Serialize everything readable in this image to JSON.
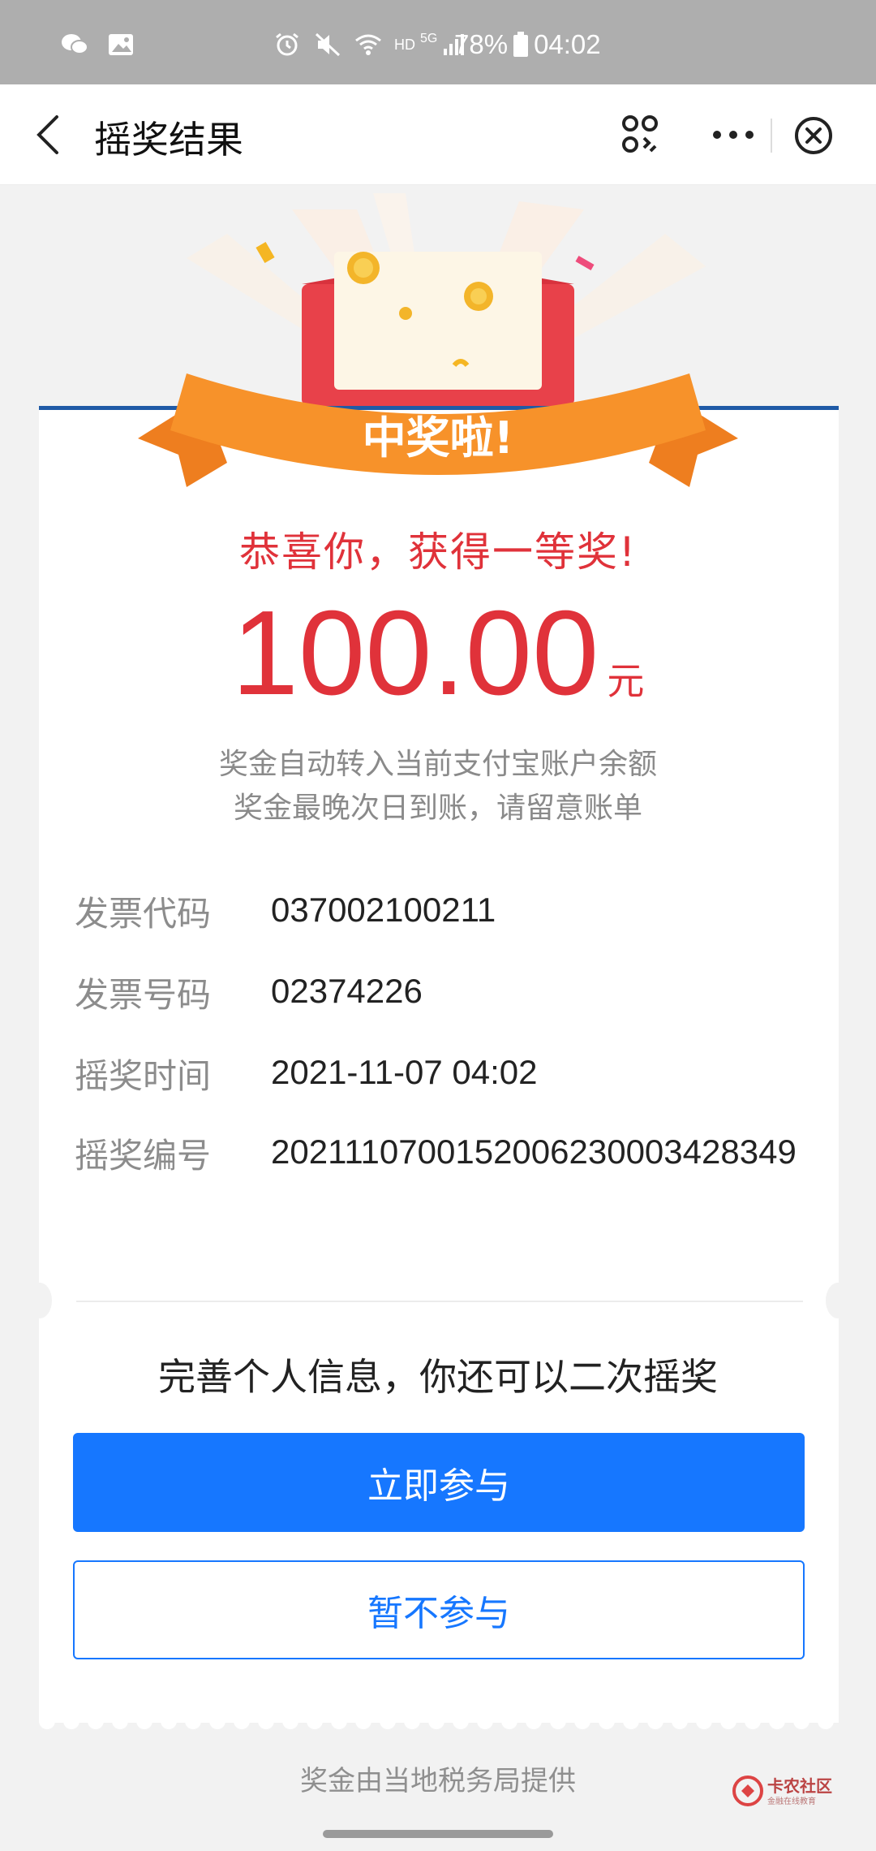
{
  "status_bar": {
    "battery_percent": "78%",
    "time": "04:02",
    "network": "HD",
    "signal": "5G"
  },
  "nav": {
    "title": "摇奖结果"
  },
  "banner": {
    "text": "中奖啦!"
  },
  "result": {
    "congrats": "恭喜你，获得一等奖!",
    "amount": "100.00",
    "unit": "元",
    "desc_line1": "奖金自动转入当前支付宝账户余额",
    "desc_line2": "奖金最晚次日到账，请留意账单"
  },
  "info": [
    {
      "label": "发票代码",
      "value": "037002100211"
    },
    {
      "label": "发票号码",
      "value": "02374226"
    },
    {
      "label": "摇奖时间",
      "value": "2021-11-07 04:02"
    },
    {
      "label": "摇奖编号",
      "value": "2021110700152006230003428349"
    }
  ],
  "second_chance": {
    "text": "完善个人信息，你还可以二次摇奖",
    "primary_button": "立即参与",
    "secondary_button": "暂不参与"
  },
  "footer": {
    "text": "奖金由当地税务局提供",
    "watermark": "卡农社区",
    "watermark_sub": "金融在线教育"
  },
  "colors": {
    "accent_red": "#e0323a",
    "primary_blue": "#1677ff",
    "banner_orange": "#f7922a",
    "envelope_red": "#e8414a"
  }
}
